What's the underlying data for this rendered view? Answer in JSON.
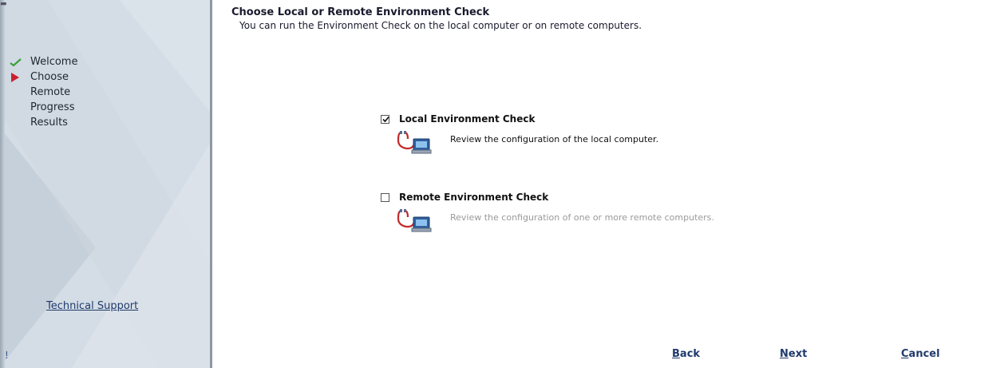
{
  "sidebar": {
    "steps": [
      {
        "label": "Welcome",
        "state": "done"
      },
      {
        "label": "Choose",
        "state": "current"
      },
      {
        "label": "Remote",
        "state": "pending"
      },
      {
        "label": "Progress",
        "state": "pending"
      },
      {
        "label": "Results",
        "state": "pending"
      }
    ],
    "tech_support_label": "Technical Support",
    "bottom_mark": "!"
  },
  "main": {
    "title": "Choose Local or Remote Environment Check",
    "subtitle": "You can run the Environment Check on the local computer or on remote computers.",
    "options": [
      {
        "label": "Local Environment Check",
        "checked": true,
        "description": "Review the configuration of the local computer.",
        "icon": "stethoscope-computer-icon"
      },
      {
        "label": "Remote Environment Check",
        "checked": false,
        "description": "Review the configuration of one or more remote computers.",
        "icon": "stethoscope-computer-icon"
      }
    ]
  },
  "buttons": {
    "back_label": "Back",
    "next_label": "Next",
    "cancel_label": "Cancel"
  },
  "colors": {
    "sidebar_bg": "#d4dde6",
    "done_check": "#3aa03a",
    "current_arrow": "#cc1f2f",
    "link": "#1f3a6b"
  }
}
